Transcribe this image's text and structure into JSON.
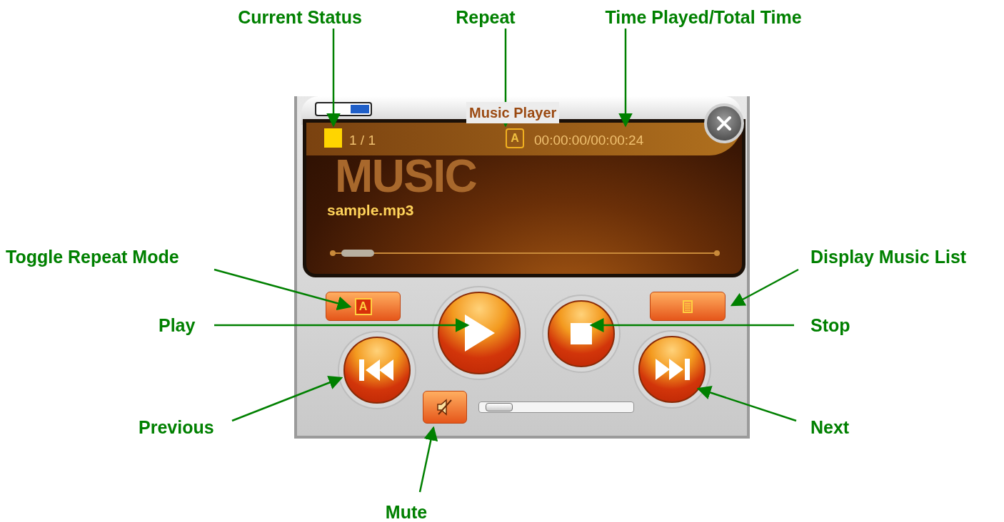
{
  "callouts": [
    {
      "label": "Current Status"
    },
    {
      "label": "Repeat"
    },
    {
      "label": "Time Played/Total Time"
    },
    {
      "label": "Toggle Repeat Mode"
    },
    {
      "label": "Display Music List"
    },
    {
      "label": "Play"
    },
    {
      "label": "Stop"
    },
    {
      "label": "Previous"
    },
    {
      "label": "Next"
    },
    {
      "label": "Mute"
    }
  ],
  "player": {
    "title": "Music Player",
    "stopped": true,
    "track_count": "1 / 1",
    "repeat_indicator": "A",
    "time": "00:00:00/00:00:24",
    "background_text": "MUSIC",
    "file": "sample.mp3",
    "progress": {
      "level": 0.03
    },
    "repeat_button": "A",
    "muted": true,
    "volume": {
      "level": 0.05
    }
  }
}
